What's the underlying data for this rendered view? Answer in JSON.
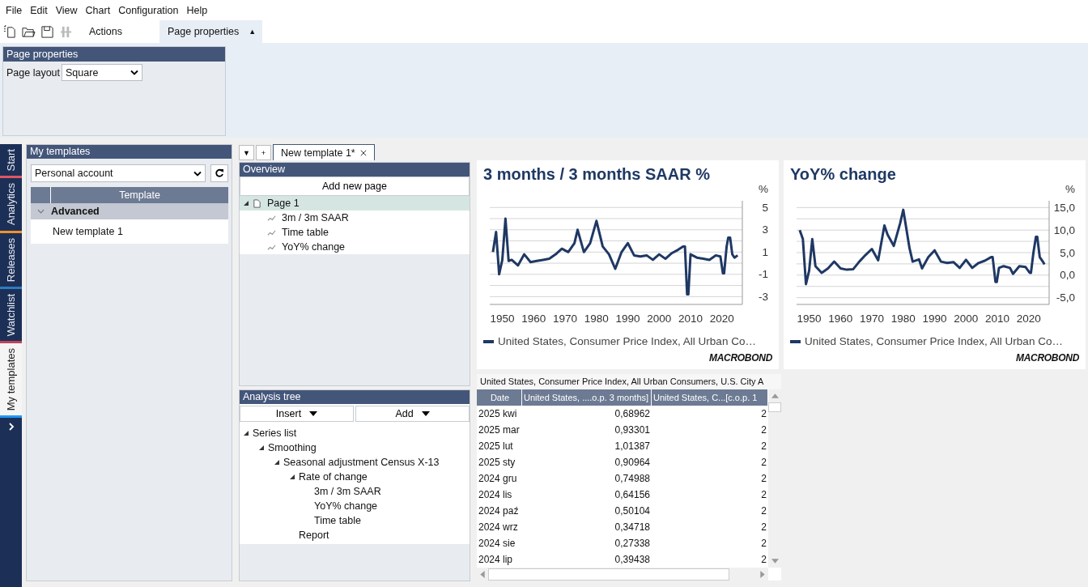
{
  "menu": [
    "File",
    "Edit",
    "View",
    "Chart",
    "Configuration",
    "Help"
  ],
  "toolbar_icons": [
    {
      "disabled": false
    },
    {
      "disabled": false
    },
    {
      "disabled": false
    },
    {
      "disabled": true
    }
  ],
  "ribbon_tabs": [
    {
      "label": "Actions",
      "selected": false
    },
    {
      "label": "Page properties",
      "selected": true
    }
  ],
  "ribbon_collapse": "▲",
  "ribbon": {
    "group_title": "Page properties",
    "field_label": "Page layout",
    "layout_value": "Square"
  },
  "side_tabs": [
    {
      "label": "Start",
      "color": "#e05563",
      "selected": false
    },
    {
      "label": "Analytics",
      "color": "#f0922b",
      "selected": false
    },
    {
      "label": "Releases",
      "color": "#2f7bbf",
      "selected": false
    },
    {
      "label": "Watchlist",
      "color": "#c0445a",
      "selected": false
    },
    {
      "label": "My templates",
      "color": "#2196f3",
      "selected": true
    }
  ],
  "templates_panel": {
    "title": "My templates",
    "account": "Personal account",
    "column": "Template",
    "groups": [
      {
        "name": "Advanced",
        "expanded": true,
        "items": [
          "New template 1"
        ]
      }
    ]
  },
  "doc_tab_buttons": [
    "▼",
    "+"
  ],
  "doc_tabs": [
    {
      "label": "New template 1*",
      "selected": true
    }
  ],
  "overview": {
    "title": "Overview",
    "add_button": "Add new page",
    "tree": [
      {
        "label": "Page 1",
        "kind": "page",
        "expanded": true,
        "selected": true,
        "children": [
          {
            "label": "3m / 3m SAAR",
            "kind": "chart",
            "selected": false
          },
          {
            "label": "Time table",
            "kind": "chart",
            "selected": false
          },
          {
            "label": "YoY% change",
            "kind": "chart",
            "selected": false
          }
        ]
      }
    ]
  },
  "analysis": {
    "title": "Analysis tree",
    "buttons": [
      "Insert",
      "Add"
    ],
    "tree": [
      {
        "label": "Series list",
        "expanded": true,
        "children": [
          {
            "label": "Smoothing",
            "expanded": true,
            "children": [
              {
                "label": "Seasonal adjustment Census X-13",
                "expanded": true,
                "children": [
                  {
                    "label": "Rate of change",
                    "expanded": true,
                    "children": [
                      {
                        "label": "3m / 3m SAAR"
                      },
                      {
                        "label": "YoY% change"
                      },
                      {
                        "label": "Time table"
                      }
                    ]
                  },
                  {
                    "label": "Report"
                  }
                ]
              }
            ]
          }
        ]
      }
    ]
  },
  "charts": [
    {
      "brand": "MACROBOND",
      "chart_data": {
        "type": "line",
        "title": "3 months / 3 months SAAR %",
        "ylabel": "%",
        "x": [
          1947,
          1948,
          1949,
          1950,
          1951,
          1952,
          1953,
          1955,
          1957,
          1959,
          1961,
          1963,
          1965,
          1967,
          1969,
          1971,
          1973,
          1974,
          1976,
          1978,
          1980,
          1982,
          1984,
          1986,
          1988,
          1990,
          1992,
          1994,
          1996,
          1998,
          2000,
          2002,
          2004,
          2006,
          2007.6,
          2008.2,
          2008.9,
          2009.3,
          2010,
          2012,
          2014,
          2016,
          2018,
          2019.5,
          2020.3,
          2020.7,
          2021.5,
          2022,
          2022.6,
          2023.3,
          2024,
          2025
        ],
        "series": [
          {
            "name": "United States, Consumer Price Index, All Urban Co…",
            "color": "#1f3864",
            "values": [
              1.0,
              2.8,
              -1.0,
              0.3,
              4.0,
              0.2,
              0.3,
              -0.2,
              0.8,
              0.1,
              0.2,
              0.3,
              0.4,
              0.8,
              1.3,
              1.0,
              1.8,
              3.0,
              1.0,
              1.8,
              3.8,
              1.5,
              0.8,
              -0.5,
              1.0,
              1.8,
              0.7,
              0.6,
              0.7,
              0.3,
              0.8,
              0.4,
              0.9,
              1.2,
              1.5,
              1.5,
              -2.8,
              -2.8,
              0.8,
              0.5,
              0.4,
              0.3,
              0.7,
              0.6,
              -0.9,
              -0.9,
              1.5,
              2.3,
              2.3,
              0.8,
              0.5,
              0.7
            ]
          }
        ],
        "xlim": [
          1946,
          2026.5
        ],
        "ylim": [
          -3.7,
          5.6
        ],
        "grid": true,
        "xticks": [
          1950,
          1960,
          1970,
          1980,
          1990,
          2000,
          2010,
          2020
        ],
        "yticks": [
          5,
          3,
          1,
          -1,
          -3
        ]
      }
    },
    {
      "brand": "MACROBOND",
      "chart_data": {
        "type": "line",
        "title": "YoY% change",
        "ylabel": "%",
        "x": [
          1947,
          1948,
          1949,
          1950,
          1951,
          1952,
          1954,
          1956,
          1958,
          1960,
          1962,
          1964,
          1966,
          1968,
          1970,
          1972,
          1974,
          1975,
          1977,
          1979,
          1980,
          1982,
          1983,
          1985,
          1986,
          1988,
          1990,
          1992,
          1994,
          1996,
          1998,
          2000,
          2002,
          2004,
          2006,
          2008,
          2008.5,
          2009.4,
          2009.8,
          2010.5,
          2012,
          2014,
          2015,
          2017,
          2019,
          2020.3,
          2020.7,
          2021.5,
          2022.3,
          2022.7,
          2023.5,
          2024.5,
          2025
        ],
        "series": [
          {
            "name": "United States, Consumer Price Index, All Urban Co…",
            "color": "#1f3864",
            "values": [
              10,
              8,
              -2,
              1,
              8,
              2,
              0.5,
              1.5,
              3,
              1.5,
              1.2,
              1.3,
              3,
              4.5,
              5.8,
              3.3,
              11,
              9,
              6.5,
              11.5,
              14.5,
              6,
              3,
              3.5,
              1.5,
              4,
              5.5,
              3,
              2.7,
              2.9,
              1.6,
              3.4,
              1.6,
              2.7,
              3.2,
              4,
              4,
              -1.5,
              -1.5,
              1.6,
              2,
              1.6,
              0.3,
              2,
              1.8,
              0.5,
              0.5,
              5,
              8.5,
              8.5,
              4,
              3,
              2.4
            ]
          }
        ],
        "xlim": [
          1946,
          2026.5
        ],
        "ylim": [
          -6.5,
          16.5
        ],
        "grid": true,
        "xticks": [
          1950,
          1960,
          1970,
          1980,
          1990,
          2000,
          2010,
          2020
        ],
        "yticks": [
          {
            "value": 15,
            "label": "15,0"
          },
          {
            "value": 10,
            "label": "10,0"
          },
          {
            "value": 5,
            "label": "5,0"
          },
          {
            "value": 0,
            "label": "0,0"
          },
          {
            "value": -5,
            "label": "-5,0"
          }
        ]
      }
    }
  ],
  "table": {
    "caption": "United States, Consumer Price Index, All Urban Consumers, U.S. City A",
    "columns": [
      "Date",
      "United States, ....o.p. 3 months]",
      "United States, C...[c.o.p. 1"
    ],
    "rows": [
      [
        "2025 kwi",
        "0,68962",
        "2"
      ],
      [
        "2025 mar",
        "0,93301",
        "2"
      ],
      [
        "2025 lut",
        "1,01387",
        "2"
      ],
      [
        "2025 sty",
        "0,90964",
        "2"
      ],
      [
        "2024 gru",
        "0,74988",
        "2"
      ],
      [
        "2024 lis",
        "0,64156",
        "2"
      ],
      [
        "2024 paź",
        "0,50104",
        "2"
      ],
      [
        "2024 wrz",
        "0,34718",
        "2"
      ],
      [
        "2024 sie",
        "0,27338",
        "2"
      ],
      [
        "2024 lip",
        "0,39438",
        "2"
      ]
    ]
  }
}
